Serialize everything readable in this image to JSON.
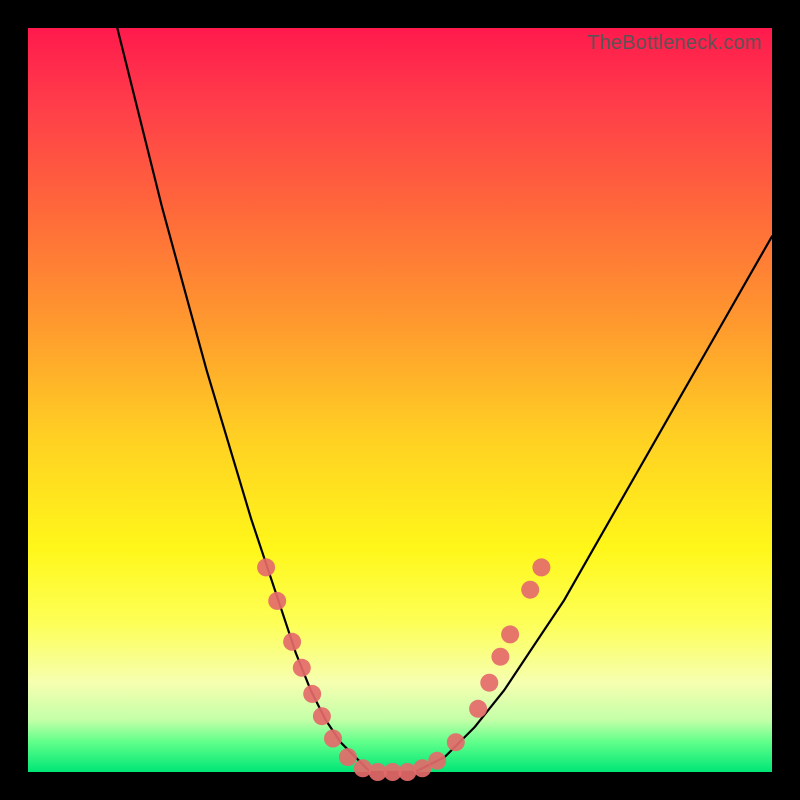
{
  "watermark": "TheBottleneck.com",
  "chart_data": {
    "type": "line",
    "title": "",
    "xlabel": "",
    "ylabel": "",
    "xlim": [
      0,
      100
    ],
    "ylim": [
      0,
      100
    ],
    "series": [
      {
        "name": "bottleneck-curve",
        "x": [
          12,
          15,
          18,
          21,
          24,
          27,
          30,
          32,
          34,
          36,
          38,
          40,
          42,
          44,
          46,
          48,
          52,
          56,
          60,
          64,
          68,
          72,
          76,
          80,
          84,
          88,
          92,
          96,
          100
        ],
        "y": [
          100,
          88,
          76,
          65,
          54,
          44,
          34,
          28,
          22,
          16,
          11,
          7,
          4,
          2,
          0,
          0,
          0,
          2,
          6,
          11,
          17,
          23,
          30,
          37,
          44,
          51,
          58,
          65,
          72
        ]
      }
    ],
    "markers": {
      "name": "highlight-dots",
      "color": "#e46a6a",
      "points": [
        {
          "x": 32.0,
          "y": 27.5
        },
        {
          "x": 33.5,
          "y": 23.0
        },
        {
          "x": 35.5,
          "y": 17.5
        },
        {
          "x": 36.8,
          "y": 14.0
        },
        {
          "x": 38.2,
          "y": 10.5
        },
        {
          "x": 39.5,
          "y": 7.5
        },
        {
          "x": 41.0,
          "y": 4.5
        },
        {
          "x": 43.0,
          "y": 2.0
        },
        {
          "x": 45.0,
          "y": 0.5
        },
        {
          "x": 47.0,
          "y": 0.0
        },
        {
          "x": 49.0,
          "y": 0.0
        },
        {
          "x": 51.0,
          "y": 0.0
        },
        {
          "x": 53.0,
          "y": 0.5
        },
        {
          "x": 55.0,
          "y": 1.5
        },
        {
          "x": 57.5,
          "y": 4.0
        },
        {
          "x": 60.5,
          "y": 8.5
        },
        {
          "x": 62.0,
          "y": 12.0
        },
        {
          "x": 63.5,
          "y": 15.5
        },
        {
          "x": 64.8,
          "y": 18.5
        },
        {
          "x": 67.5,
          "y": 24.5
        },
        {
          "x": 69.0,
          "y": 27.5
        }
      ]
    }
  }
}
